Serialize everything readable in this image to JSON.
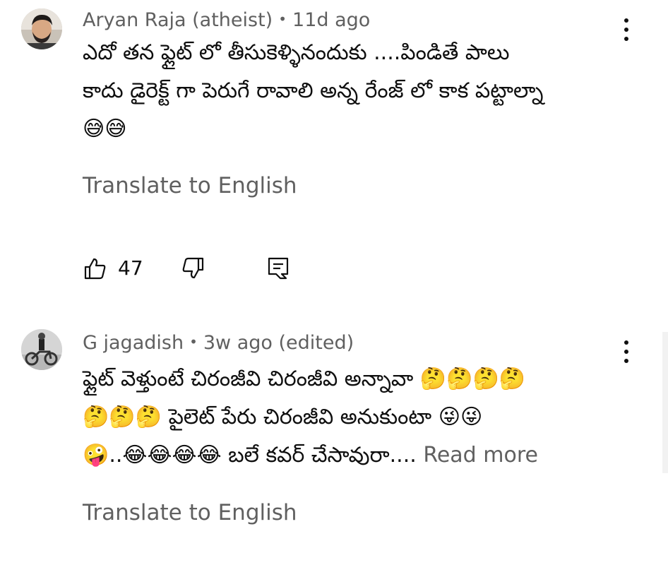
{
  "comments": [
    {
      "author": "Aryan Raja (atheist)",
      "separator": "•",
      "time": "11d ago",
      "lines": [
        "ఎదో తన ఫ్లైట్ లో తీసుకెళ్ళినందుకు ....పిండితే పాలు",
        "కాదు డైరెక్ట్ గా పెరుగే రావాలి అన్న రేంజ్ లో కాక పట్టాల్నా"
      ],
      "emoji_line": "😅😅",
      "translate_label": "Translate to English",
      "likes": "47",
      "avatar": "bearded-man-avatar"
    },
    {
      "author": "G jagadish",
      "separator": "•",
      "time": "3w ago (edited)",
      "lines": [
        "ఫ్లైట్ వెళ్తుంటే చిరంజీవి చిరంజీవి అన్నావా 🤔🤔🤔🤔",
        "🤔🤔🤔 పైలెట్ పేరు చిరంజీవి అనుకుంటా 😜😜",
        "🤪..😂😂😂😂 బలే కవర్ చేసావురా...."
      ],
      "read_more": "Read more",
      "translate_label": "Translate to English",
      "avatar": "motorcycle-rider-avatar"
    }
  ],
  "icons": {
    "like": "thumbs-up-icon",
    "dislike": "thumbs-down-icon",
    "reply": "reply-comment-icon",
    "menu": "more-vertical-icon"
  },
  "colors": {
    "text_primary": "#0f0f0f",
    "text_secondary": "#606060",
    "background": "#ffffff"
  }
}
